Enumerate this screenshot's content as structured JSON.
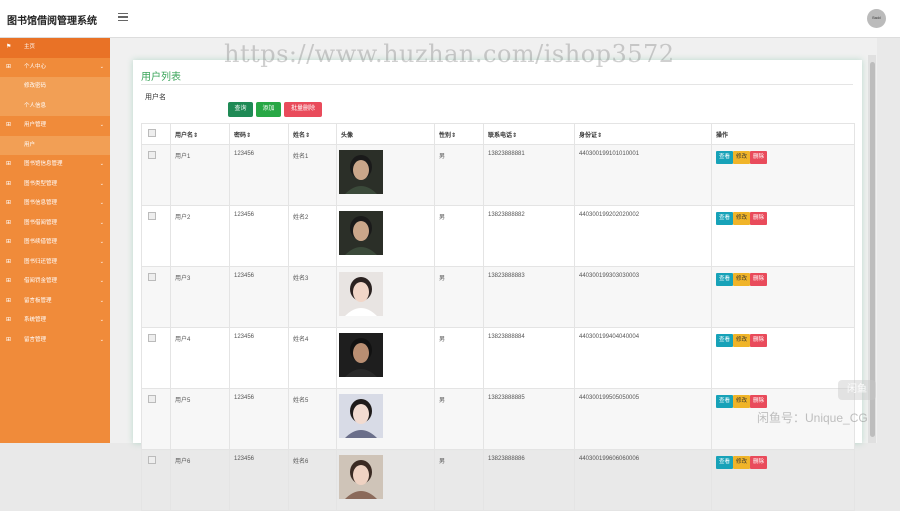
{
  "app": {
    "title": "图书馆借阅管理系统",
    "avatar_text": "Badd"
  },
  "sidebar": {
    "items": [
      {
        "label": "主页",
        "icon": "flag-icon",
        "caret": ""
      },
      {
        "label": "个人中心",
        "icon": "grid-icon",
        "caret": "⌄"
      },
      {
        "label": "修改密码",
        "sub": true
      },
      {
        "label": "个人信息",
        "sub": true
      },
      {
        "label": "用户管理",
        "icon": "grid-icon",
        "caret": "⌄"
      },
      {
        "label": "用户",
        "sub": true
      },
      {
        "label": "图书馆信息管理",
        "icon": "grid-icon",
        "caret": "⌄"
      },
      {
        "label": "图书类型管理",
        "icon": "grid-icon",
        "caret": "⌄"
      },
      {
        "label": "图书信息管理",
        "icon": "grid-icon",
        "caret": "⌄"
      },
      {
        "label": "图书借阅管理",
        "icon": "grid-icon",
        "caret": "⌄"
      },
      {
        "label": "图书续借管理",
        "icon": "grid-icon",
        "caret": "⌄"
      },
      {
        "label": "图书归还管理",
        "icon": "grid-icon",
        "caret": "⌄"
      },
      {
        "label": "借阅罚金管理",
        "icon": "grid-icon",
        "caret": "⌄"
      },
      {
        "label": "留言板管理",
        "icon": "grid-icon",
        "caret": "⌄"
      },
      {
        "label": "系统管理",
        "icon": "grid-icon",
        "caret": "⌄"
      },
      {
        "label": "留言管理",
        "icon": "grid-icon",
        "caret": "⌄"
      }
    ]
  },
  "main": {
    "title": "用户列表",
    "search": {
      "label": "用户名",
      "value": ""
    },
    "buttons": {
      "search": "查询",
      "add": "添加",
      "batch_delete": "批量删除"
    },
    "table": {
      "headers": [
        "用户名⇕",
        "密码⇕",
        "姓名⇕",
        "头像",
        "性别⇕",
        "联系电话⇕",
        "身份证⇕",
        "操作"
      ],
      "actions": {
        "view": "查看",
        "edit": "修改",
        "delete": "删除"
      },
      "rows": [
        {
          "username": "用户1",
          "password": "123456",
          "name": "姓名1",
          "gender": "男",
          "phone": "13823888881",
          "idcard": "440300199101010001",
          "avatar": "dark-man"
        },
        {
          "username": "用户2",
          "password": "123456",
          "name": "姓名2",
          "gender": "男",
          "phone": "13823888882",
          "idcard": "440300199202020002",
          "avatar": "dark-man"
        },
        {
          "username": "用户3",
          "password": "123456",
          "name": "姓名3",
          "gender": "男",
          "phone": "13823888883",
          "idcard": "440300199303030003",
          "avatar": "light-woman"
        },
        {
          "username": "用户4",
          "password": "123456",
          "name": "姓名4",
          "gender": "男",
          "phone": "13823888884",
          "idcard": "440300199404040004",
          "avatar": "dark-man2"
        },
        {
          "username": "用户5",
          "password": "123456",
          "name": "姓名5",
          "gender": "男",
          "phone": "13823888885",
          "idcard": "440300199505050005",
          "avatar": "woman2"
        },
        {
          "username": "用户6",
          "password": "123456",
          "name": "姓名6",
          "gender": "男",
          "phone": "13823888886",
          "idcard": "440300199606060006",
          "avatar": "woman3"
        }
      ]
    }
  },
  "watermarks": {
    "url": "https://www.huzhan.com/ishop3572",
    "corner": "闲鱼号：Unique_CG",
    "logo": "闲鱼"
  },
  "colors": {
    "sidebar": "#f08b3a",
    "title": "#3aa55a",
    "view": "#17a2b8",
    "edit": "#f0b429",
    "delete": "#e94b5b"
  }
}
